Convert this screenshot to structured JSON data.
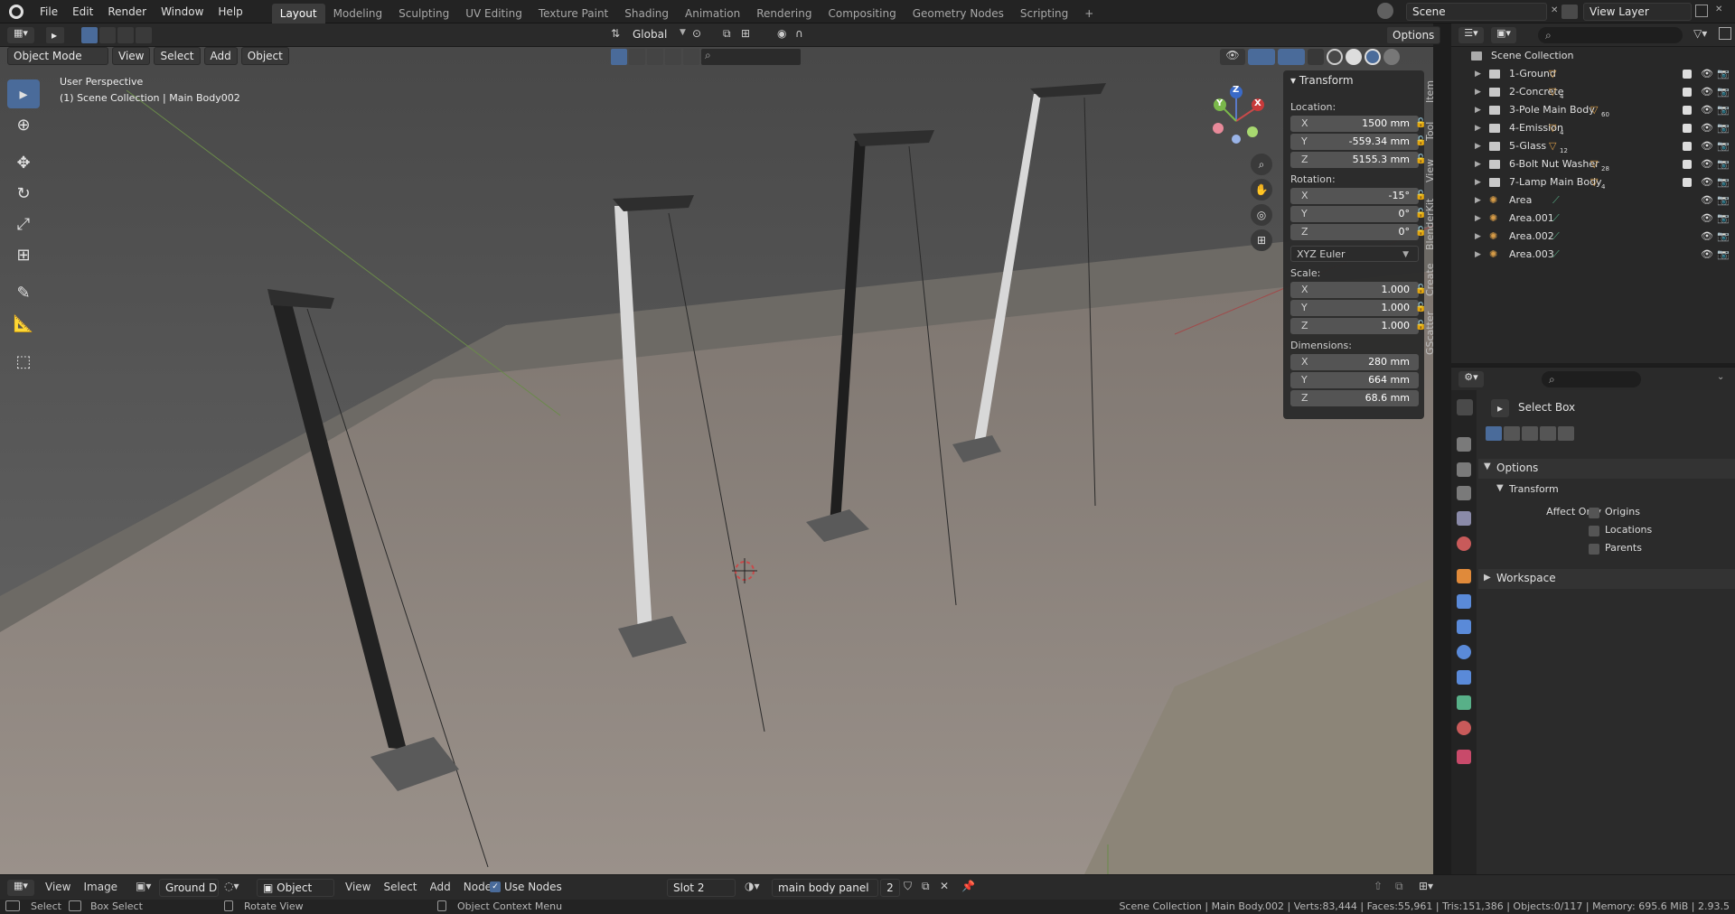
{
  "topbar": {
    "menus": [
      "File",
      "Edit",
      "Render",
      "Window",
      "Help"
    ],
    "workspaces": [
      "Layout",
      "Modeling",
      "Sculpting",
      "UV Editing",
      "Texture Paint",
      "Shading",
      "Animation",
      "Rendering",
      "Compositing",
      "Geometry Nodes",
      "Scripting"
    ],
    "active_workspace": "Layout",
    "add_tab": "+",
    "scene": "Scene",
    "view_layer": "View Layer"
  },
  "viewport_header": {
    "mode": "Object Mode",
    "menus": [
      "View",
      "Select",
      "Add",
      "Object"
    ],
    "orientation": "Global",
    "options": "Options"
  },
  "viewport": {
    "perspective": "User Perspective",
    "collection_info": "(1) Scene Collection | Main Body002"
  },
  "gizmo": {
    "x": "X",
    "y": "Y",
    "z": "Z"
  },
  "npanel": {
    "title": "Transform",
    "location_label": "Location:",
    "location": [
      {
        "axis": "X",
        "value": "1500 mm"
      },
      {
        "axis": "Y",
        "value": "-559.34 mm"
      },
      {
        "axis": "Z",
        "value": "5155.3 mm"
      }
    ],
    "rotation_label": "Rotation:",
    "rotation": [
      {
        "axis": "X",
        "value": "-15°"
      },
      {
        "axis": "Y",
        "value": "0°"
      },
      {
        "axis": "Z",
        "value": "0°"
      }
    ],
    "rotation_mode": "XYZ Euler",
    "scale_label": "Scale:",
    "scale": [
      {
        "axis": "X",
        "value": "1.000"
      },
      {
        "axis": "Y",
        "value": "1.000"
      },
      {
        "axis": "Z",
        "value": "1.000"
      }
    ],
    "dimensions_label": "Dimensions:",
    "dimensions": [
      {
        "axis": "X",
        "value": "280 mm"
      },
      {
        "axis": "Y",
        "value": "664 mm"
      },
      {
        "axis": "Z",
        "value": "68.6 mm"
      }
    ],
    "side_tabs": [
      "Item",
      "Tool",
      "View",
      "BlenderKit",
      "Create",
      "GScatter"
    ]
  },
  "outliner": {
    "root": "Scene Collection",
    "items": [
      {
        "name": "1-Ground",
        "badge": "",
        "type": "collection"
      },
      {
        "name": "2-Concrete",
        "badge": "4",
        "type": "collection"
      },
      {
        "name": "3-Pole Main Body",
        "badge": "60",
        "type": "collection"
      },
      {
        "name": "4-Emission",
        "badge": "4",
        "type": "collection"
      },
      {
        "name": "5-Glass",
        "badge": "12",
        "type": "collection"
      },
      {
        "name": "6-Bolt Nut Washer",
        "badge": "28",
        "type": "collection"
      },
      {
        "name": "7-Lamp Main Body",
        "badge": "4",
        "type": "collection"
      },
      {
        "name": "Area",
        "badge": "",
        "type": "light"
      },
      {
        "name": "Area.001",
        "badge": "",
        "type": "light"
      },
      {
        "name": "Area.002",
        "badge": "",
        "type": "light"
      },
      {
        "name": "Area.003",
        "badge": "",
        "type": "light"
      }
    ]
  },
  "properties": {
    "tool_name": "Select Box",
    "options_label": "Options",
    "transform_label": "Transform",
    "affect_only_label": "Affect Only",
    "checks": [
      "Origins",
      "Locations",
      "Parents"
    ],
    "workspace_label": "Workspace"
  },
  "bottom_header": {
    "menus": [
      "View",
      "Image"
    ],
    "image_field": "Ground Di",
    "object_dropdown": "Object",
    "node_menus": [
      "View",
      "Select",
      "Add",
      "Node"
    ],
    "use_nodes": "Use Nodes",
    "slot": "Slot 2",
    "material": "main body panel",
    "users": "2"
  },
  "statusbar": {
    "select": "Select",
    "box_select": "Box Select",
    "rotate_view": "Rotate View",
    "context_menu": "Object Context Menu",
    "stats": "Scene Collection | Main Body.002 | Verts:83,444 | Faces:55,961 | Tris:151,386 | Objects:0/117 | Memory: 695.6 MiB | 2.93.5"
  },
  "colors": {
    "accent": "#4a6b9a",
    "collection_icon": "#d79c47",
    "light_icon": "#58b088"
  }
}
